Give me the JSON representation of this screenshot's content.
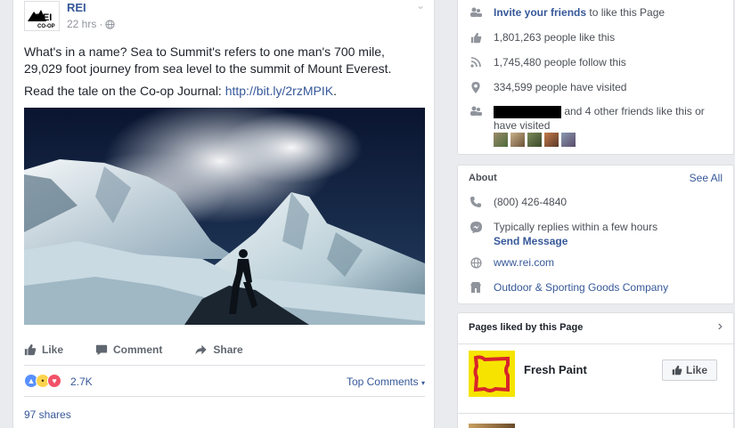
{
  "post": {
    "page_name": "REI",
    "logo_text": "REI",
    "logo_subtext": "CO-OP",
    "time": "22 hrs",
    "dot": "·",
    "text_line1": "What's in a name? Sea to Summit's refers to one man's 700 mile, 29,029 foot journey from sea level to the summit of Mount Everest.",
    "text_line2_prefix": "Read the tale on the Co-op Journal: ",
    "text_link": "http://bit.ly/2rzMPIK",
    "text_line2_suffix": ".",
    "actions": {
      "like": "Like",
      "comment": "Comment",
      "share": "Share"
    },
    "reaction_count": "2.7K",
    "top_comments": "Top Comments",
    "shares": "97 shares"
  },
  "info": {
    "invite_link": "Invite your friends",
    "invite_suffix": " to like this Page",
    "likes": "1,801,263 people like this",
    "follows": "1,745,480 people follow this",
    "visited": "334,599 people have visited",
    "friends_suffix": " and 4 other friends like this or have visited"
  },
  "about": {
    "title": "About",
    "see_all": "See All",
    "phone": "(800) 426-4840",
    "replies": "Typically replies within a few hours",
    "send_message": "Send Message",
    "website": "www.rei.com",
    "category": "Outdoor & Sporting Goods Company"
  },
  "pages_liked": {
    "title": "Pages liked by this Page",
    "items": [
      {
        "name": "Fresh Paint",
        "like_label": "Like"
      }
    ]
  },
  "colors": {
    "link": "#365899",
    "like_blue": "#5890ff",
    "love_red": "#f25268",
    "wow_yellow": "#fcd34d",
    "fresh_paint_yellow": "#f6e400",
    "fresh_paint_red": "#d8252a"
  },
  "icons": {
    "like": "thumbs-up-icon",
    "comment": "speech-bubble-icon",
    "share": "share-arrow-icon",
    "globe": "globe-icon",
    "phone": "phone-icon",
    "messenger": "messenger-icon",
    "category": "shop-icon",
    "rss": "rss-icon",
    "pin": "location-pin-icon",
    "friends": "friends-icon"
  }
}
